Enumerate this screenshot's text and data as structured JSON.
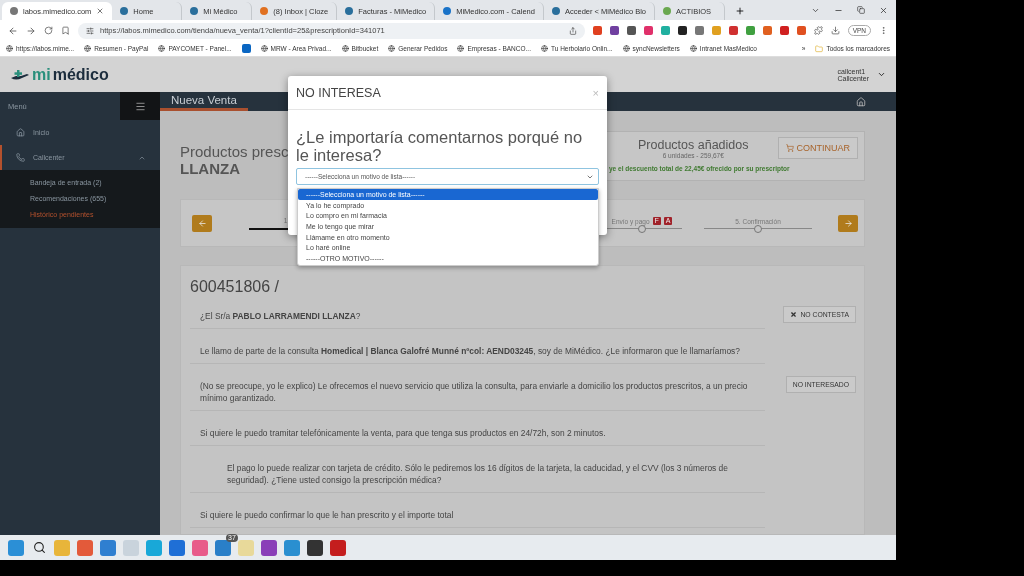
{
  "browser": {
    "tabs": [
      {
        "title": "labos.mimedico.com",
        "selected": true
      },
      {
        "title": "Home",
        "selected": false
      },
      {
        "title": "Mi Médico",
        "selected": false
      },
      {
        "title": "(8) Inbox | Cloze",
        "selected": false
      },
      {
        "title": "Facturas - MiMedico",
        "selected": false
      },
      {
        "title": "MiMedico.com - Calend",
        "selected": false
      },
      {
        "title": "Acceder < MiMédico Blo",
        "selected": false
      },
      {
        "title": "ACTIBIOS",
        "selected": false
      }
    ],
    "url": "https://labos.mimedico.com/tienda/nueva_venta/1?clientId=25&prescriptionId=341071",
    "vpn": "VPN",
    "bookmarks": [
      {
        "kind": "link",
        "label": "https://labos.mime..."
      },
      {
        "kind": "link",
        "label": "Resumen - PayPal"
      },
      {
        "kind": "link",
        "label": "PAYCOMET - Panel..."
      },
      {
        "kind": "icon"
      },
      {
        "kind": "link",
        "label": "MRW - Area Privad..."
      },
      {
        "kind": "link",
        "label": "Bitbucket"
      },
      {
        "kind": "link",
        "label": "Generar Pedidos"
      },
      {
        "kind": "link",
        "label": "Empresas - BANCO..."
      },
      {
        "kind": "link",
        "label": "Tu Herbolario Onlin..."
      },
      {
        "kind": "link",
        "label": "syncNewsletters"
      },
      {
        "kind": "link",
        "label": "Intranet MasMedico"
      }
    ],
    "more_bookmarks": "»",
    "all_bookmarks": "Todos los marcadores"
  },
  "app": {
    "logo": {
      "part_1": "mi",
      "part_2": "médico"
    },
    "user": {
      "name": "callcent1",
      "role": "Callcenter"
    },
    "menu_label": "Menú",
    "sidebar": [
      {
        "label": "Inicio",
        "expanded": false
      },
      {
        "label": "Callcenter",
        "expanded": true,
        "children": [
          {
            "label": "Bandeja de entrada (2)",
            "selected": false
          },
          {
            "label": "Recomendaciones (655)",
            "selected": false
          },
          {
            "label": "Histórico pendientes",
            "selected": true
          }
        ]
      }
    ],
    "page_title": "Nueva Venta",
    "heading": {
      "line_1": "Productos presc",
      "line_2": "LLANZA"
    },
    "summary": {
      "title": "Productos añadidos",
      "subtitle": "6 unidades - 259,67€",
      "button": "CONTINUAR",
      "discount": "ye el descuento total de 22,45€ ofrecido por su prescriptor"
    },
    "steps": [
      {
        "label": "1",
        "done": true
      },
      {
        "label": "Envío y pago",
        "done": false,
        "badges": [
          "F",
          "A"
        ]
      },
      {
        "label": "5. Confirmación",
        "done": false
      }
    ],
    "script": {
      "title": "600451806 /",
      "rows": [
        {
          "kind": "plain",
          "text": "¿El Sr/a **PABLO LARRAMENDI LLANZA**?",
          "action": {
            "label": "NO CONTESTA",
            "icon": true
          }
        },
        {
          "kind": "plain",
          "text": "Le llamo de parte de la consulta **Homedical | Blanca Galofré Munné nºcol: AEND03245**, soy de MiMédico. ¿Le informaron que le llamaríamos?"
        },
        {
          "kind": "plain",
          "text": "(No se preocupe, yo le explico) Le ofrecemos el nuevo servicio que utiliza la consulta, para enviarle a domicilio los productos prescritos, a un precio mínimo garantizado.",
          "action": {
            "label": "NO INTERESADO",
            "icon": false
          }
        },
        {
          "kind": "plain",
          "text": "Si quiere le puedo tramitar telefónicamente la venta, para que tenga sus productos en 24/72h, son 2 minutos."
        },
        {
          "kind": "indented",
          "text": "El pago lo puede realizar con tarjeta de crédito. Sólo le pediremos los 16 dígitos de la tarjeta, la caducidad, y el CVV (los 3 números de seguridad). ¿Tiene usted consigo la prescripción médica?"
        },
        {
          "kind": "plain",
          "text": "Si quiere le puedo confirmar lo que le han prescrito y el importe total"
        }
      ]
    }
  },
  "modal": {
    "title": "NO INTERESA",
    "close": "×",
    "question": "¿Le importaría comentarnos porqué no le interesa?",
    "select_value": "------Selecciona un motivo de lista------",
    "options": [
      {
        "label": "------Selecciona un motivo de lista------",
        "selected": true
      },
      {
        "label": "Ya lo he comprado",
        "selected": false
      },
      {
        "label": "Lo compro en mi farmacia",
        "selected": false
      },
      {
        "label": "Me lo tengo que mirar",
        "selected": false
      },
      {
        "label": "Llámame en otro momento",
        "selected": false
      },
      {
        "label": "Lo haré online",
        "selected": false
      },
      {
        "label": "------OTRO MOTIVO------",
        "selected": false
      }
    ]
  },
  "taskbar": {
    "badge": "37"
  }
}
